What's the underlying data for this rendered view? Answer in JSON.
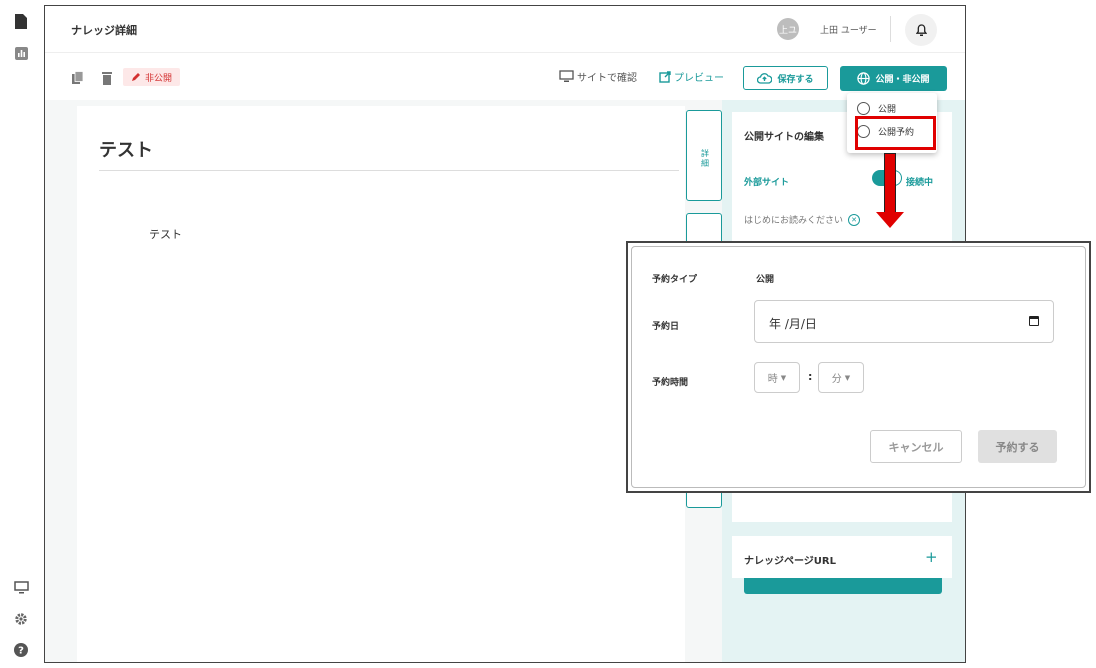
{
  "header": {
    "title": "ナレッジ詳細",
    "avatar_initials": "上ユ",
    "user_name": "上田 ユーザー"
  },
  "toolbar": {
    "status_badge": "非公開",
    "site_check_label": "サイトで確認",
    "preview_label": "プレビュー",
    "save_label": "保存する",
    "publish_label": "公開・非公開"
  },
  "publish_menu": {
    "options": [
      "公開",
      "公開予約"
    ],
    "highlighted": "公開予約"
  },
  "document": {
    "title": "テスト",
    "body": "テスト"
  },
  "side_tabs": {
    "detail": "詳細"
  },
  "right_panel": {
    "edit_title": "公開サイトの編集",
    "external_site_label": "外部サイト",
    "toggle_status": "接続中",
    "readme_label": "はじめにお読みください",
    "url_section_label": "ナレッジページURL"
  },
  "schedule_modal": {
    "type_label": "予約タイプ",
    "type_value": "公開",
    "date_label": "予約日",
    "date_placeholder": "年 /月/日",
    "time_label": "予約時間",
    "hour_placeholder": "時",
    "minute_placeholder": "分",
    "cancel_label": "キャンセル",
    "reserve_label": "予約する"
  },
  "colors": {
    "accent": "#1a9a9a",
    "danger": "#e00000",
    "panel_bg": "#e4f3f3"
  }
}
